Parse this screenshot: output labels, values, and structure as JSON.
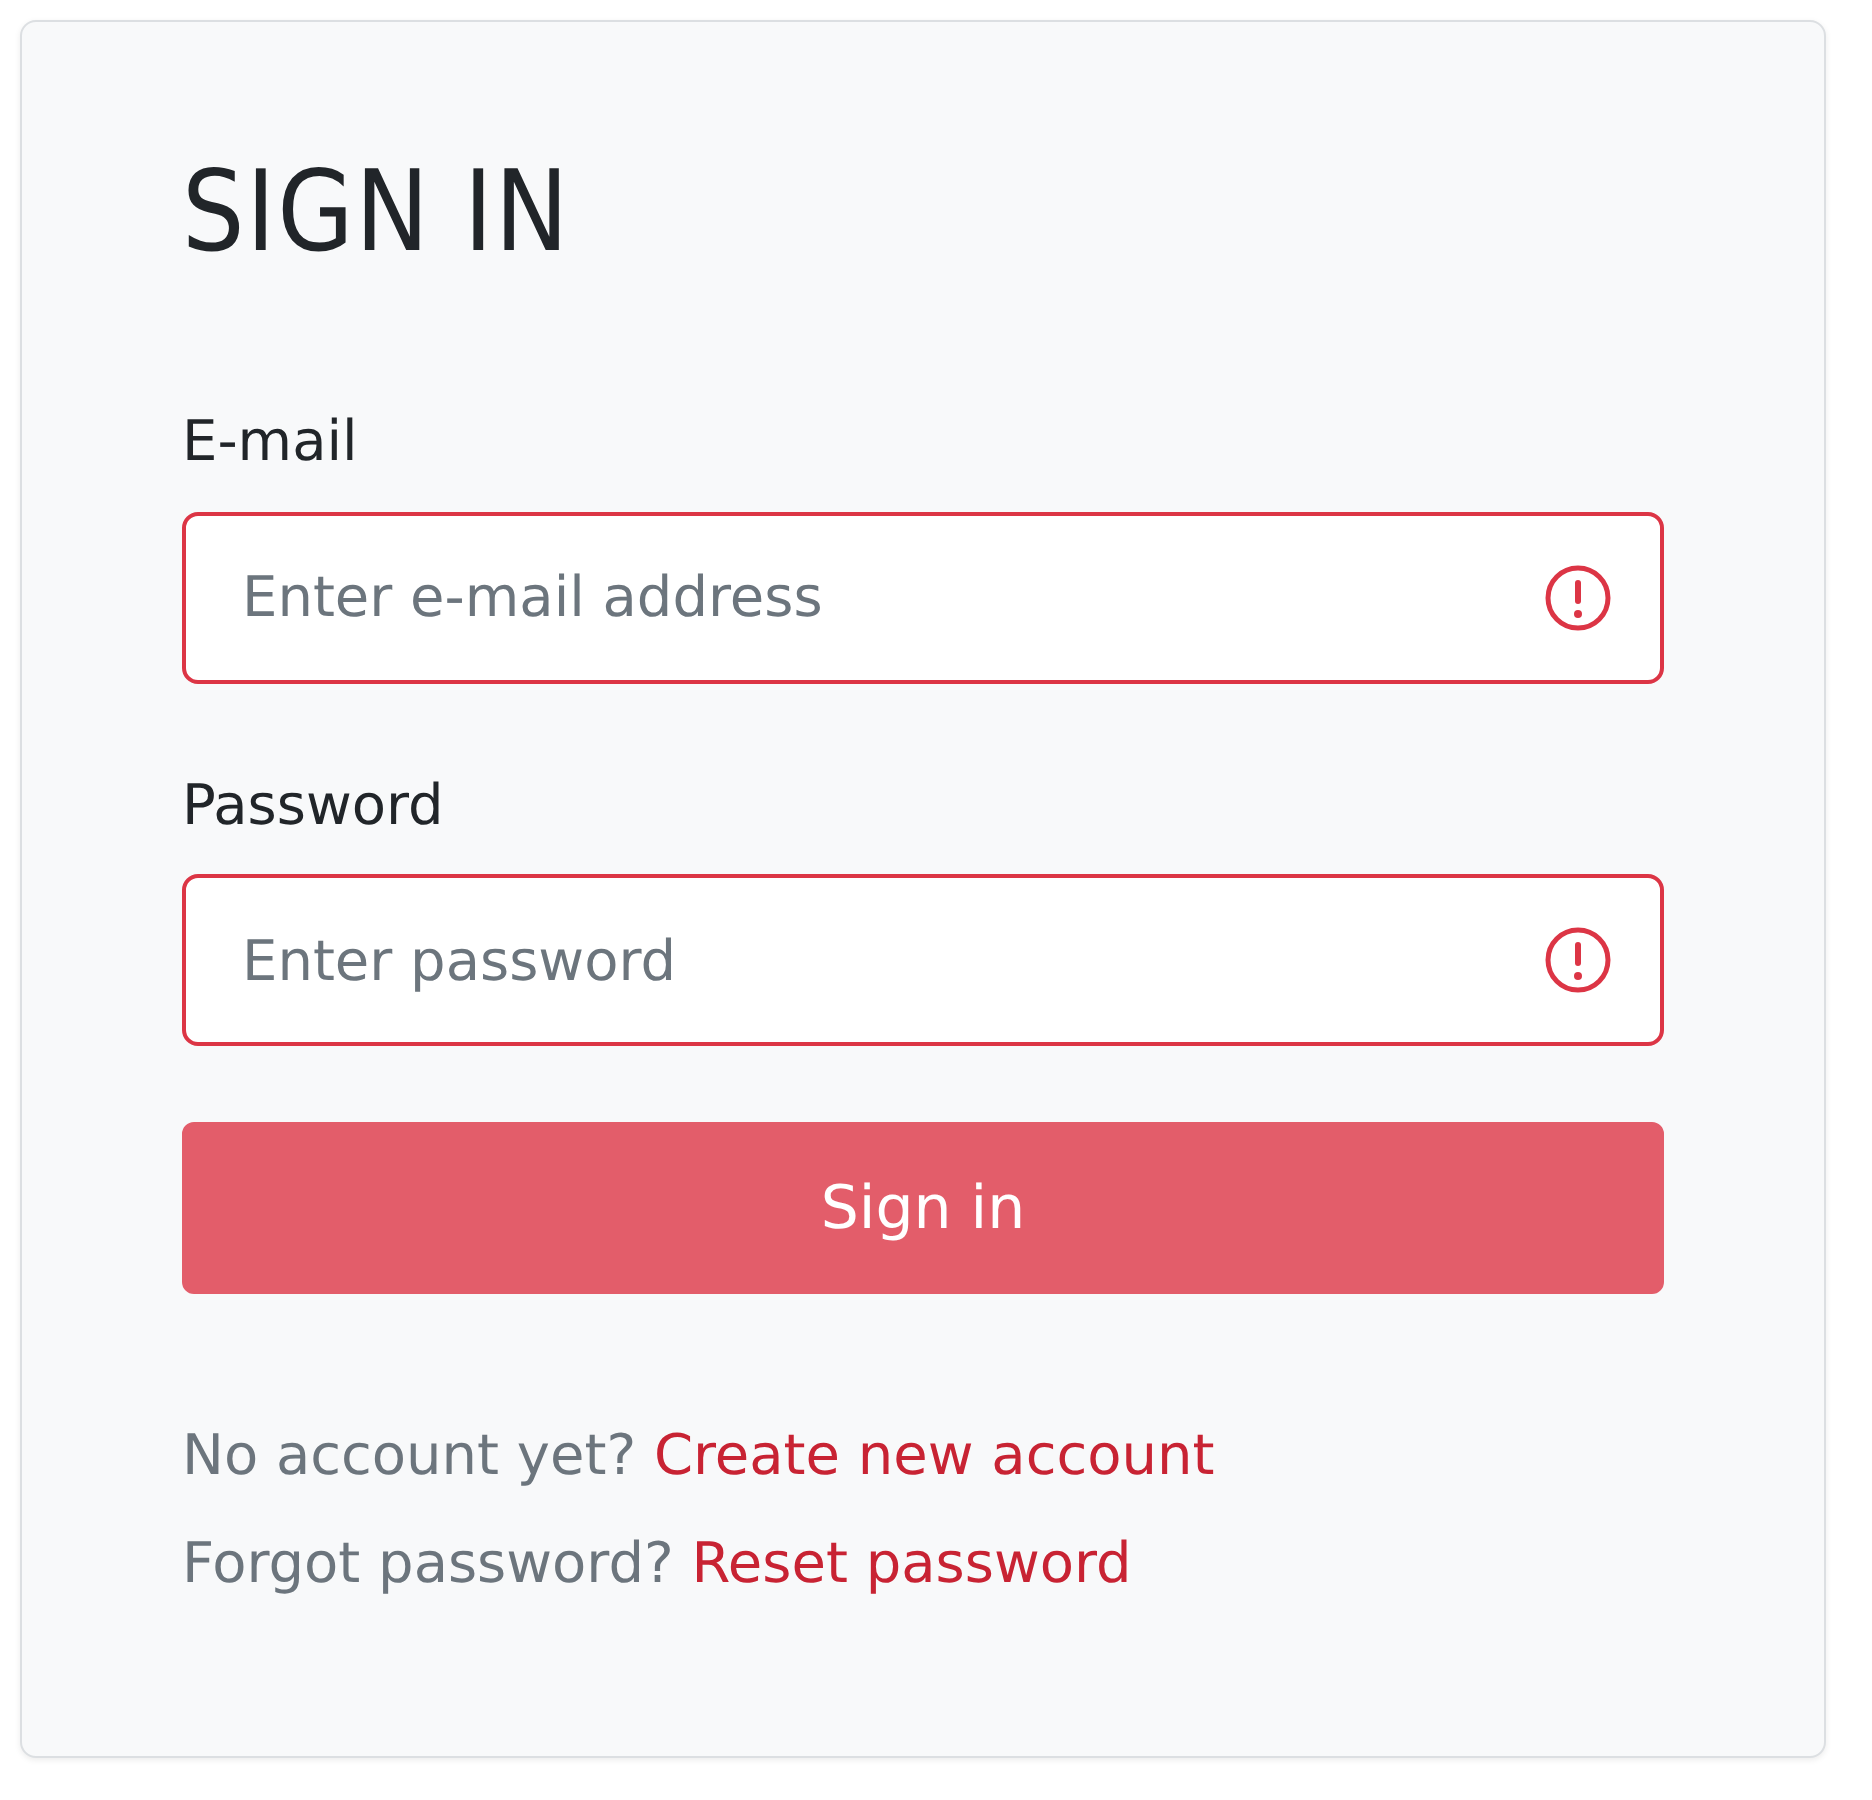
{
  "title": "SIGN IN",
  "fields": [
    {
      "label": "E-mail",
      "placeholder": "Enter e-mail address",
      "invalid": true
    },
    {
      "label": "Password",
      "placeholder": "Enter password",
      "invalid": true
    }
  ],
  "submit": {
    "label": "Sign in",
    "disabled": true
  },
  "links": [
    {
      "text": "No account yet?",
      "link": "Create new account"
    },
    {
      "text": "Forgot password?",
      "link": "Reset password"
    }
  ]
}
